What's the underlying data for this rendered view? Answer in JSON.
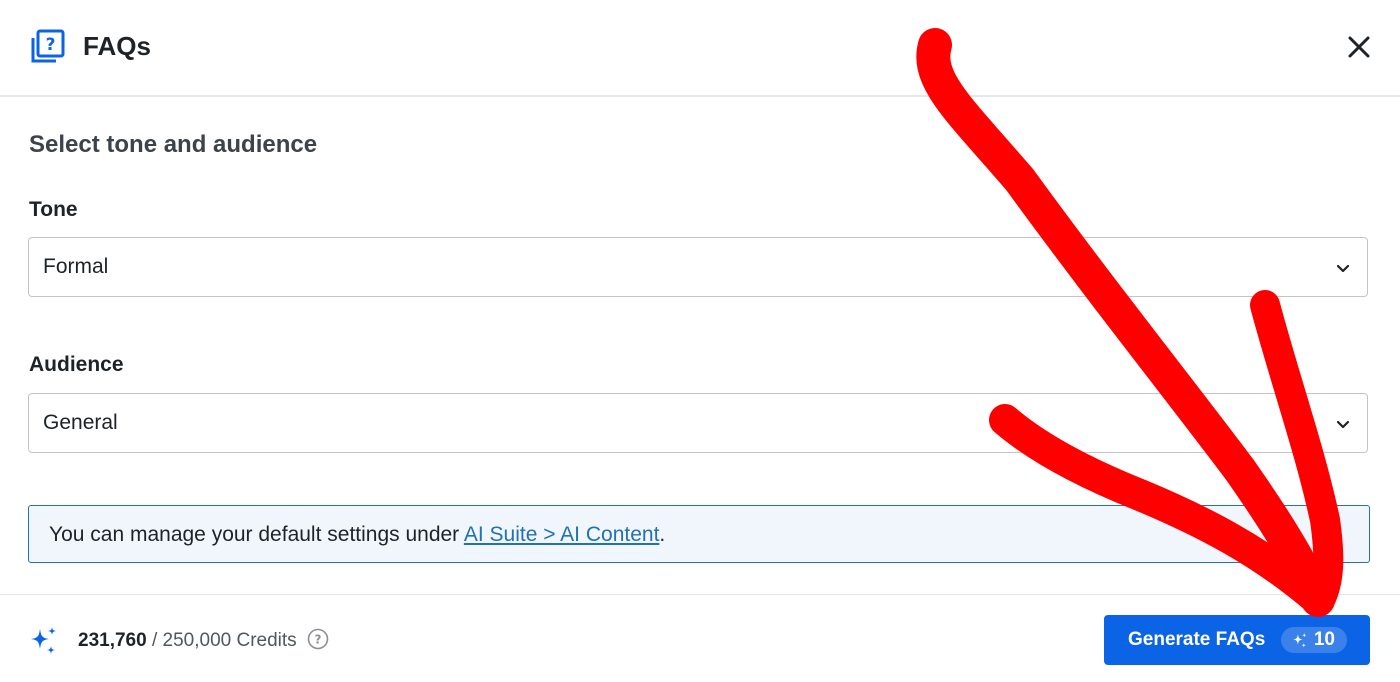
{
  "header": {
    "title": "FAQs",
    "logo_icon": "faq-question-icon",
    "close_icon": "close-icon"
  },
  "section_title": "Select tone and audience",
  "tone": {
    "label": "Tone",
    "selected": "Formal"
  },
  "audience": {
    "label": "Audience",
    "selected": "General"
  },
  "notice": {
    "text_before": "You can manage your default settings under ",
    "link_text": "AI Suite > AI Content",
    "text_after": "."
  },
  "footer": {
    "credits_used": "231,760",
    "credits_rest": " / 250,000 Credits",
    "generate_label": "Generate FAQs",
    "generate_cost": "10"
  },
  "colors": {
    "primary": "#0b63e5",
    "link": "#2271b1",
    "notice_bg": "#f0f6fc",
    "annotation_red": "#ff0000"
  }
}
